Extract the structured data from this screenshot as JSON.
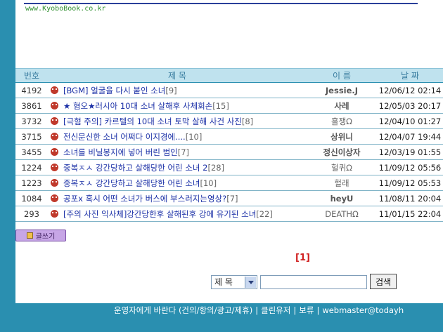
{
  "banner": {
    "site_url": "www.KyoboBook.co.kr"
  },
  "table": {
    "headers": {
      "no": "번호",
      "title": "제 목",
      "name": "이 름",
      "date": "날 짜"
    },
    "rows": [
      {
        "no": "4192",
        "title": "[BGM] 얼굴을 다시 붙인 소녀",
        "count": "[9]",
        "name": "Jessie.J",
        "date": "12/06/12 02:14"
      },
      {
        "no": "3861",
        "title": "★ 혐오★러시아 10대 소녀 살해후 사체회손",
        "count": "[15]",
        "name": "사레",
        "date": "12/05/03 20:17"
      },
      {
        "no": "3732",
        "title": "[극혐 주의] 카르텔의 10대 소녀 토막 살해 사건 사진",
        "count": "[8]",
        "name": "홀쟁Ω",
        "date": "12/04/10 01:27"
      },
      {
        "no": "3715",
        "title": "전신문신한 소녀 어쩌다 이지경에....",
        "count": "[10]",
        "name": "상위니",
        "date": "12/04/07 19:44"
      },
      {
        "no": "3455",
        "title": "소녀를 비닐봉지에 넣어 버린 범인",
        "count": "[7]",
        "name": "정신이상자",
        "date": "12/03/19 01:55"
      },
      {
        "no": "1224",
        "title": "중복ㅈㅅ 강간당하고 살해당한 어린 소녀 2",
        "count": "[28]",
        "name": "헐퀴Ω",
        "date": "11/09/12 05:56"
      },
      {
        "no": "1223",
        "title": "중복ㅈㅅ 강간당하고 살해당한 어린 소녀",
        "count": "[10]",
        "name": "헐래",
        "date": "11/09/12 05:53"
      },
      {
        "no": "1084",
        "title": "공포x 혹시 어떤 소녀가 버스에 부스러지는영상?",
        "count": "[7]",
        "name": "heyU",
        "date": "11/08/11 20:04"
      },
      {
        "no": "293",
        "title": "[주의 사진 익사체]강간당한후 살해된후 강에 유기된 소녀",
        "count": "[22]",
        "name": "DEATHΩ",
        "date": "11/01/15 22:04"
      }
    ]
  },
  "toolbar": {
    "write_label": "글쓰기"
  },
  "pagination": {
    "current": "[1]"
  },
  "search": {
    "field_selected": "제 목",
    "query": "",
    "button_label": "검색"
  },
  "footer": {
    "items": [
      "운영자에게 바란다 (건의/항의/광고/제휴)",
      "클린유저",
      "보류",
      "webmaster@todayh"
    ],
    "separator": "|"
  },
  "colors": {
    "accent": "#2a8fb0",
    "header_bg": "#bfe2ee",
    "link": "#1a2fa6",
    "page_current": "#d02020"
  }
}
